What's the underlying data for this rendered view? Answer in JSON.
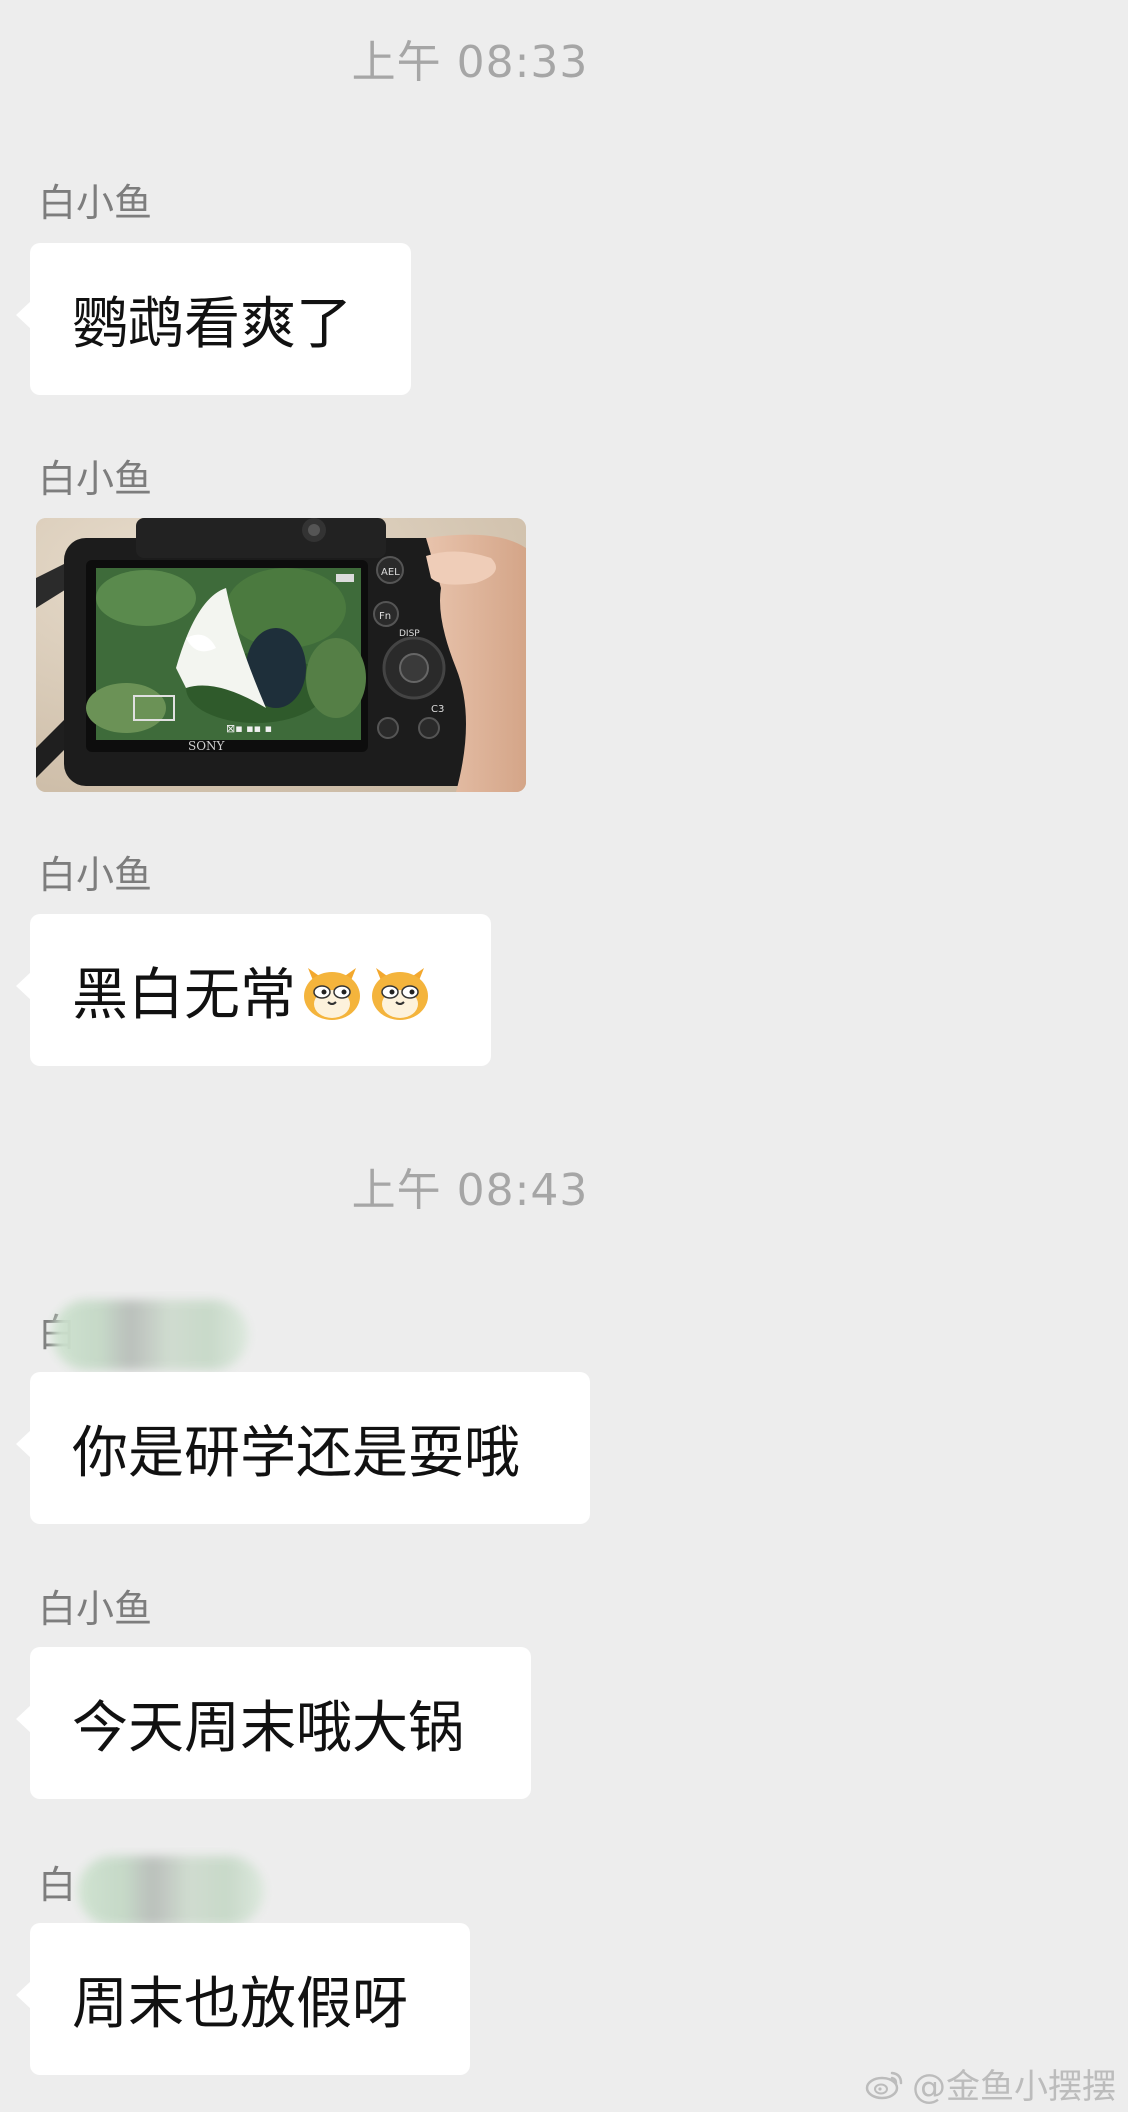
{
  "timestamps": [
    "上午 08:33",
    "上午 08:43"
  ],
  "messages": [
    {
      "sender": "白小鱼",
      "text": "鹦鹉看爽了"
    },
    {
      "sender": "白小鱼",
      "type": "image",
      "image": "camera-screen-photo"
    },
    {
      "sender": "白小鱼",
      "text": "黑白无常",
      "emoji": [
        "doge-cat-emoji",
        "doge-cat-emoji"
      ]
    },
    {
      "sender": "白",
      "sender_obscured": true,
      "text": "你是研学还是耍哦"
    },
    {
      "sender": "白小鱼",
      "text": "今天周末哦大锅"
    },
    {
      "sender": "白",
      "sender_obscured": true,
      "text": "周末也放假呀"
    }
  ],
  "photo": {
    "brand": "SONY",
    "buttons": [
      "AEL",
      "Fn",
      "DISP",
      "C3"
    ]
  },
  "watermark": {
    "icon": "weibo-icon",
    "text": "@金鱼小摆摆"
  },
  "colors": {
    "background": "#ededed",
    "bubble": "#ffffff",
    "timestamp": "#a6a6a6",
    "sender": "#7d7d7d"
  }
}
